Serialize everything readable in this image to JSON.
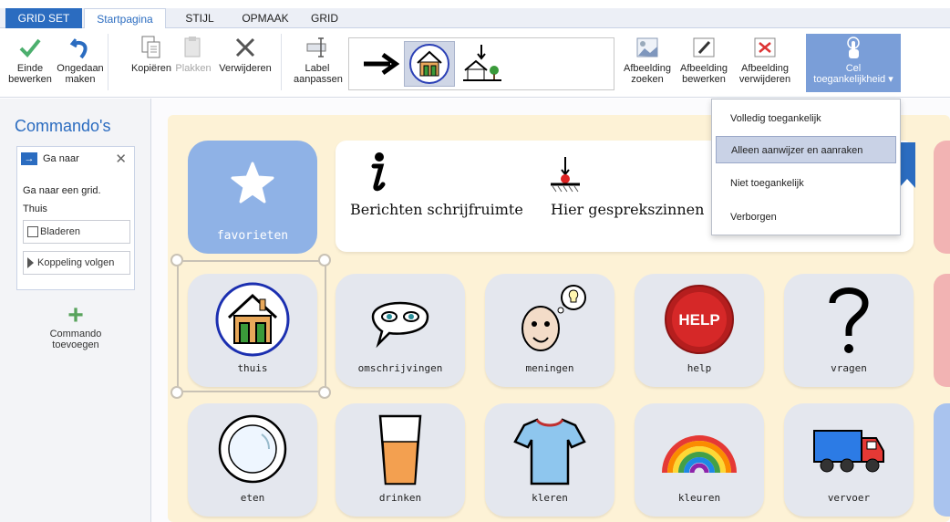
{
  "tabs": {
    "file": "GRID SET",
    "items": [
      "Startpagina",
      "STIJL",
      "OPMAAK",
      "GRID"
    ]
  },
  "ribbon": {
    "finish_edit": [
      "Einde",
      "bewerken"
    ],
    "undo": [
      "Ongedaan",
      "maken"
    ],
    "copy": "Kopiëren",
    "paste": "Plakken",
    "delete": "Verwijderen",
    "label_adjust": [
      "Label",
      "aanpassen"
    ],
    "image_find": [
      "Afbeelding",
      "zoeken"
    ],
    "image_edit": [
      "Afbeelding",
      "bewerken"
    ],
    "image_remove": [
      "Afbeelding",
      "verwijderen"
    ],
    "cell_access": [
      "Cel",
      "toegankelijkheid ▾"
    ]
  },
  "accessibility_menu": {
    "items": [
      "Volledig toegankelijk",
      "Alleen aanwijzer en aanraken",
      "Niet toegankelijk",
      "Verborgen"
    ],
    "highlighted_index": 1
  },
  "commands_panel": {
    "title": "Commando's",
    "command": {
      "name": "Ga naar",
      "description": "Ga naar een grid.",
      "value": "Thuis",
      "browse_button": "Bladeren",
      "follow_button": "Koppeling volgen"
    },
    "add_command": [
      "Commando",
      "toevoegen"
    ]
  },
  "grid": {
    "favorites_label": "favorieten",
    "message_bar": [
      "Berichten schrijfruimte",
      "Hier gesprekszinnen"
    ],
    "row1": [
      "thuis",
      "omschrijvingen",
      "meningen",
      "help",
      "vragen"
    ],
    "row2": [
      "eten",
      "drinken",
      "kleren",
      "kleuren",
      "vervoer"
    ],
    "help_sign_text": "HELP"
  },
  "colors": {
    "accent": "#2b6cc0",
    "grid_background": "#fdf2d6",
    "tile": "#e4e7ee",
    "favorites": "#8fb2e6",
    "menu_highlight": "#c9d2e6"
  }
}
